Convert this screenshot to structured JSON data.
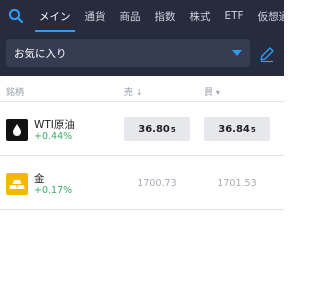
{
  "tabs": [
    {
      "label": "メイン"
    },
    {
      "label": "通貨"
    },
    {
      "label": "商品"
    },
    {
      "label": "指数"
    },
    {
      "label": "株式"
    },
    {
      "label": "ETF"
    },
    {
      "label": "仮想通貨"
    }
  ],
  "filter": {
    "selected": "お気に入り"
  },
  "table": {
    "col_name": "銘柄",
    "col_sell": "売",
    "col_buy": "買",
    "sell_arrow": "↓",
    "buy_arrow": "▾"
  },
  "rows": [
    {
      "name": "WTI原油",
      "change": "+0.44%",
      "sell_main": "36.80",
      "sell_small": "5",
      "buy_main": "36.84",
      "buy_small": "5",
      "icon": "oil-drop-icon"
    },
    {
      "name": "金",
      "change": "+0.17%",
      "sell": "1700.73",
      "buy": "1701.53",
      "icon": "gold-bars-icon"
    }
  ],
  "colors": {
    "header_bg": "#262c3e",
    "accent": "#2f9cf4",
    "positive": "#3cae66",
    "gold": "#f5b800"
  }
}
